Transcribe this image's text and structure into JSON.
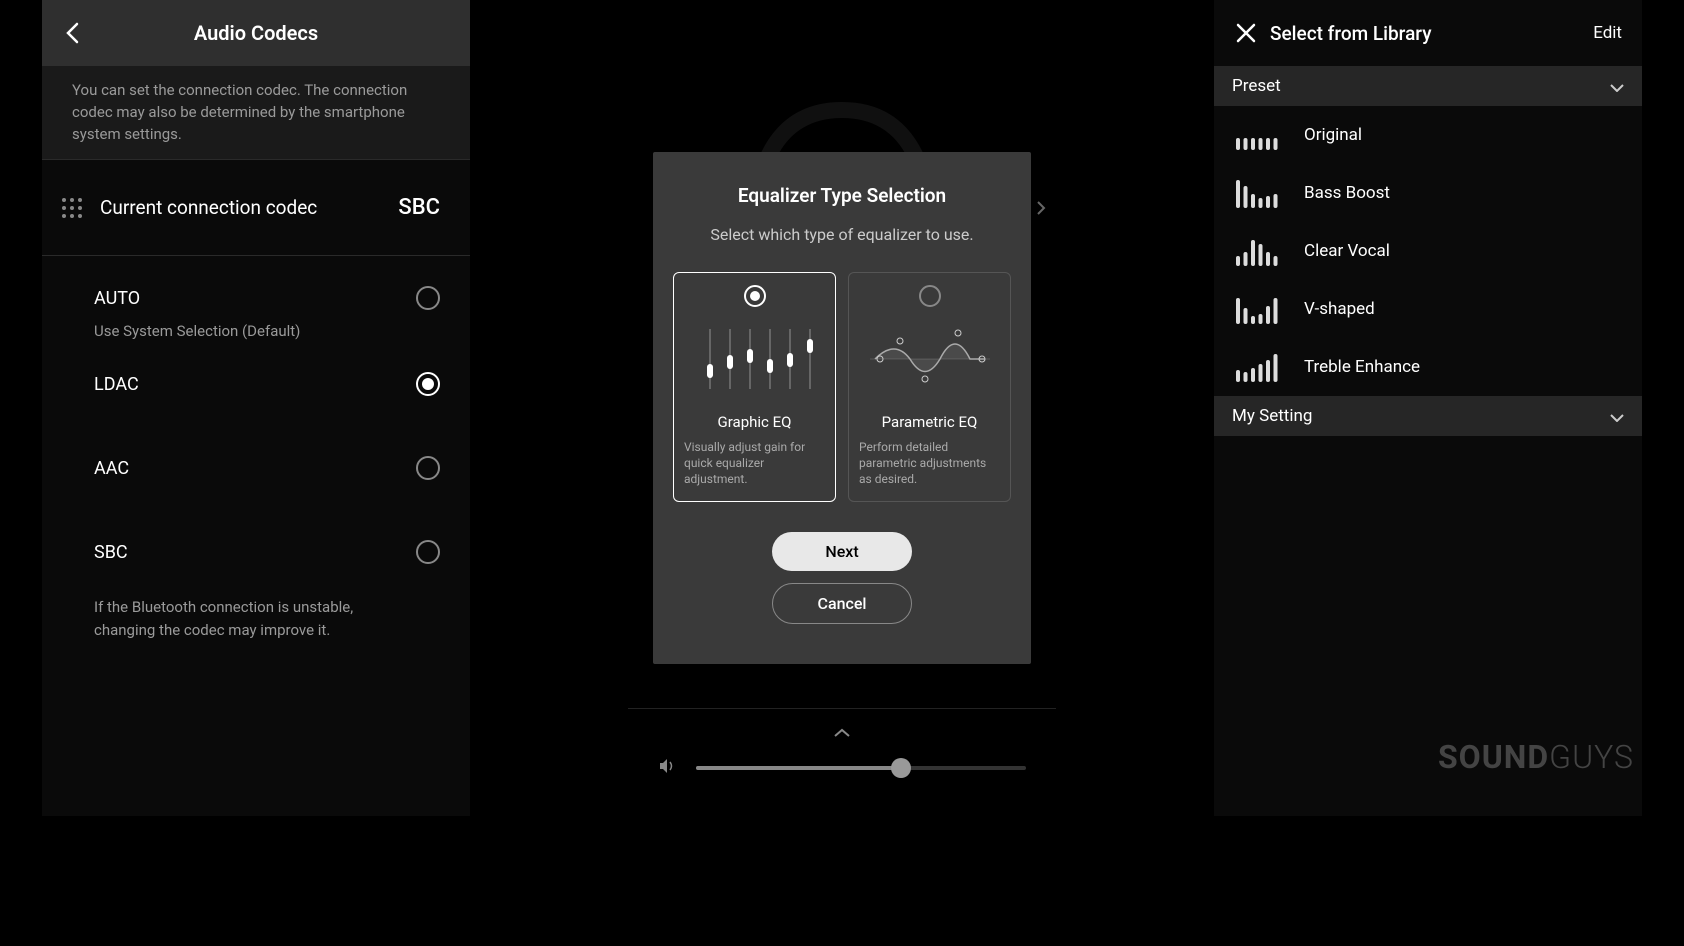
{
  "screen1": {
    "title": "Audio Codecs",
    "description": "You can set the connection codec. The connection codec may also be determined by the smartphone system settings.",
    "current_label": "Current connection codec",
    "current_value": "SBC",
    "options": [
      {
        "label": "AUTO",
        "sub": "Use System Selection (Default)",
        "selected": false
      },
      {
        "label": "LDAC",
        "sub": "",
        "selected": true
      },
      {
        "label": "AAC",
        "sub": "",
        "selected": false
      },
      {
        "label": "SBC",
        "sub": "",
        "selected": false
      }
    ],
    "footer_note": "If the Bluetooth connection is unstable, changing the codec may improve it."
  },
  "screen2": {
    "modal_title": "Equalizer Type Selection",
    "modal_sub": "Select which type of equalizer to use.",
    "options": [
      {
        "name": "Graphic EQ",
        "desc": "Visually adjust gain for quick equalizer adjustment.",
        "selected": true
      },
      {
        "name": "Parametric EQ",
        "desc": "Perform detailed parametric adjustments as desired.",
        "selected": false
      }
    ],
    "next": "Next",
    "cancel": "Cancel",
    "volume_percent": 62
  },
  "screen3": {
    "title": "Select from Library",
    "edit": "Edit",
    "preset_header": "Preset",
    "presets": [
      {
        "label": "Original",
        "bars": [
          12,
          12,
          12,
          12,
          12,
          12
        ]
      },
      {
        "label": "Bass Boost",
        "bars": [
          28,
          22,
          14,
          10,
          12,
          14
        ]
      },
      {
        "label": "Clear Vocal",
        "bars": [
          10,
          14,
          26,
          22,
          14,
          10
        ]
      },
      {
        "label": "V-shaped",
        "bars": [
          26,
          16,
          8,
          10,
          18,
          26
        ]
      },
      {
        "label": "Treble Enhance",
        "bars": [
          12,
          10,
          14,
          18,
          22,
          28
        ]
      }
    ],
    "my_setting_header": "My Setting"
  },
  "watermark": {
    "bold": "SOUND",
    "thin": "GUYS"
  }
}
